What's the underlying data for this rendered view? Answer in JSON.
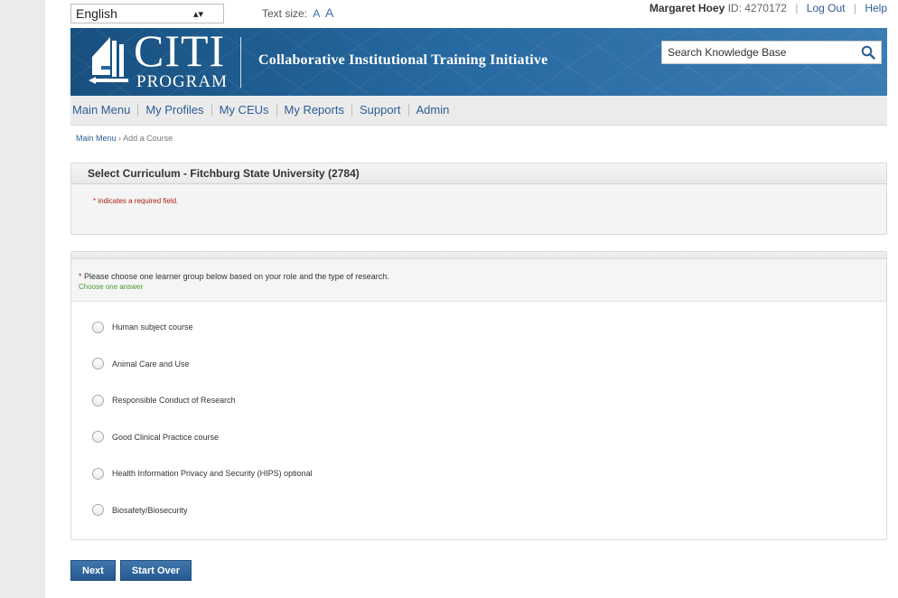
{
  "topbar": {
    "language": "English",
    "text_size_label": "Text size:",
    "text_size_small": "A",
    "text_size_large": "A",
    "user_name": "Margaret Hoey",
    "user_id": "ID: 4270172",
    "logout": "Log Out",
    "help": "Help"
  },
  "banner": {
    "logo_main": "CITI",
    "logo_sub": "PROGRAM",
    "tagline": "Collaborative Institutional Training Initiative",
    "search_placeholder": "Search Knowledge Base"
  },
  "nav": {
    "items": [
      "Main Menu",
      "My Profiles",
      "My CEUs",
      "My Reports",
      "Support",
      "Admin"
    ]
  },
  "breadcrumb": {
    "home": "Main Menu",
    "separator": "›",
    "current": "Add a Course"
  },
  "curriculum": {
    "title": "Select Curriculum - Fitchburg State University (2784)",
    "required_note": "* indicates a required field."
  },
  "question": {
    "required_mark": "*",
    "text": "Please choose one learner group below based on your role and the type of research.",
    "hint": "Choose one answer",
    "options": [
      "Human subject course",
      "Animal Care and Use",
      "Responsible Conduct of Research",
      "Good Clinical Practice course",
      "Health Information Privacy and Security (HIPS) optional",
      "Biosafety/Biosecurity"
    ]
  },
  "buttons": {
    "next": "Next",
    "start_over": "Start Over"
  },
  "colors": {
    "brand_blue": "#2668a0",
    "link_blue": "#2c5d95",
    "required_red": "#b01e1e",
    "hint_green": "#4b9a2e"
  }
}
